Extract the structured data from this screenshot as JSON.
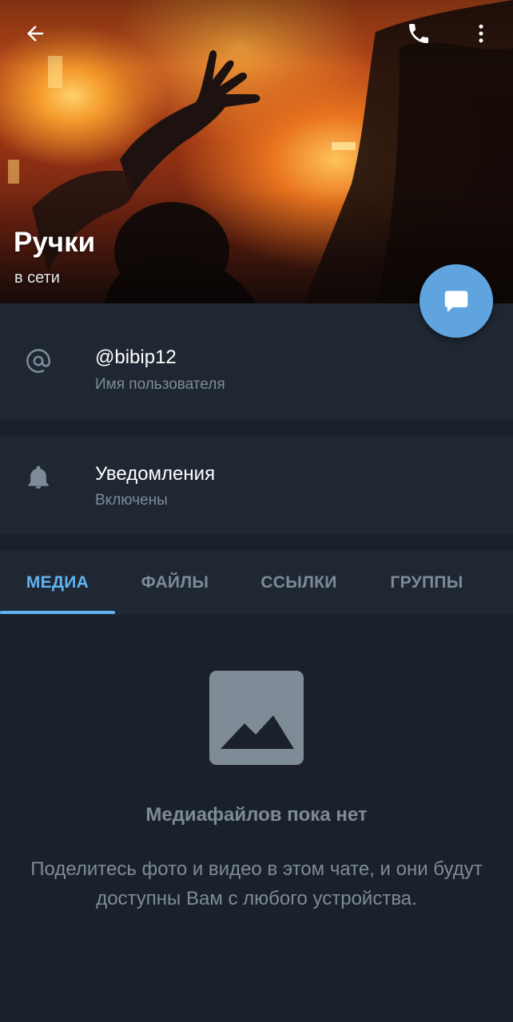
{
  "header": {
    "name": "Ручки",
    "status": "в сети",
    "back_icon": "arrow-left-icon",
    "call_icon": "phone-icon",
    "more_icon": "dots-vertical-icon"
  },
  "fab": {
    "icon": "message-icon",
    "color": "#5fa4de"
  },
  "info": {
    "username": {
      "value": "@bibip12",
      "label": "Имя пользователя",
      "icon": "at-icon"
    },
    "notifications": {
      "value": "Уведомления",
      "label": "Включены",
      "icon": "bell-icon"
    }
  },
  "tabs": [
    {
      "label": "МЕДИА",
      "active": true
    },
    {
      "label": "ФАЙЛЫ",
      "active": false
    },
    {
      "label": "ССЫЛКИ",
      "active": false
    },
    {
      "label": "ГРУППЫ",
      "active": false
    }
  ],
  "empty_state": {
    "icon": "image-placeholder-icon",
    "title": "Медиафайлов пока нет",
    "text": "Поделитесь фото и видео в этом чате, и они будут доступны Вам с любого устройства."
  },
  "colors": {
    "background": "#1a212b",
    "panel": "#1f2733",
    "accent": "#5fb3ee",
    "muted": "#7d8b99"
  }
}
